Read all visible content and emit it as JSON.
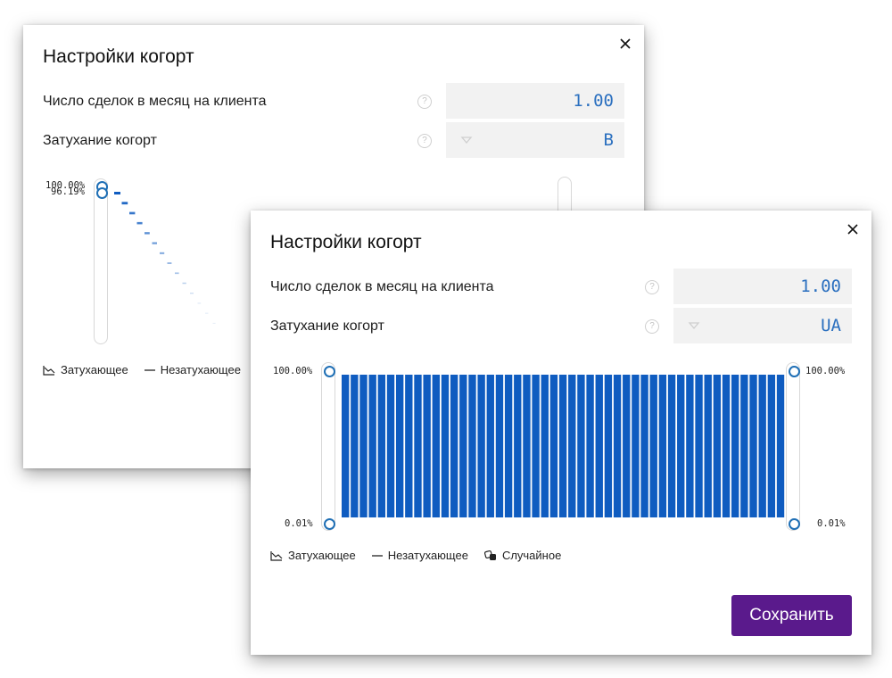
{
  "back_dialog": {
    "title": "Настройки когорт",
    "rows": [
      {
        "label": "Число сделок в месяц на клиента",
        "value": "1.00"
      },
      {
        "label": "Затухание когорт",
        "value": "B"
      }
    ],
    "chart_labels": {
      "top": "100.00%",
      "second": "96.19%"
    },
    "legend": [
      "Затухающее",
      "Незатухающее"
    ],
    "icons": [
      "close-icon",
      "help-icon",
      "caret-down-icon",
      "decaying-chart-icon",
      "flat-line-icon"
    ]
  },
  "front_dialog": {
    "title": "Настройки когорт",
    "rows": [
      {
        "label": "Число сделок в месяц на клиента",
        "value": "1.00"
      },
      {
        "label": "Затухание когорт",
        "value": "UA"
      }
    ],
    "chart_labels": {
      "left_top": "100.00%",
      "left_bottom": "0.01%",
      "right_top": "100.00%",
      "right_bottom": "0.01%"
    },
    "legend": [
      "Затухающее",
      "Незатухающее",
      "Случайное"
    ],
    "save_label": "Сохранить",
    "icons": [
      "close-icon",
      "help-icon",
      "caret-down-icon",
      "decaying-chart-icon",
      "flat-line-icon",
      "dice-icon"
    ]
  },
  "colors": {
    "accent": "#1f6fb5",
    "bar": "#0f5cc0",
    "button": "#5a1a8c",
    "value_text": "#2a6fbf"
  },
  "chart_data": [
    {
      "type": "bar",
      "title": "",
      "series": [
        {
          "values": [
            100,
            96.19,
            90,
            84,
            78,
            72,
            66,
            60,
            54,
            48,
            42,
            36,
            30,
            25,
            20,
            16,
            12
          ]
        }
      ],
      "ylim": [
        0.01,
        100
      ],
      "note_scale": "log"
    },
    {
      "type": "bar",
      "title": "",
      "series": [
        {
          "values": [
            100,
            100,
            100,
            100,
            100,
            100,
            100,
            100,
            100,
            100,
            100,
            100,
            100,
            100,
            100,
            100,
            100,
            100,
            100,
            100,
            100,
            100,
            100,
            100,
            100,
            100,
            100,
            100,
            100,
            100,
            100,
            100,
            100,
            100,
            100,
            100,
            100,
            100,
            100,
            100,
            100,
            100,
            100,
            100,
            100,
            100,
            100,
            100,
            100
          ]
        }
      ],
      "ylim": [
        0.01,
        100
      ]
    }
  ]
}
